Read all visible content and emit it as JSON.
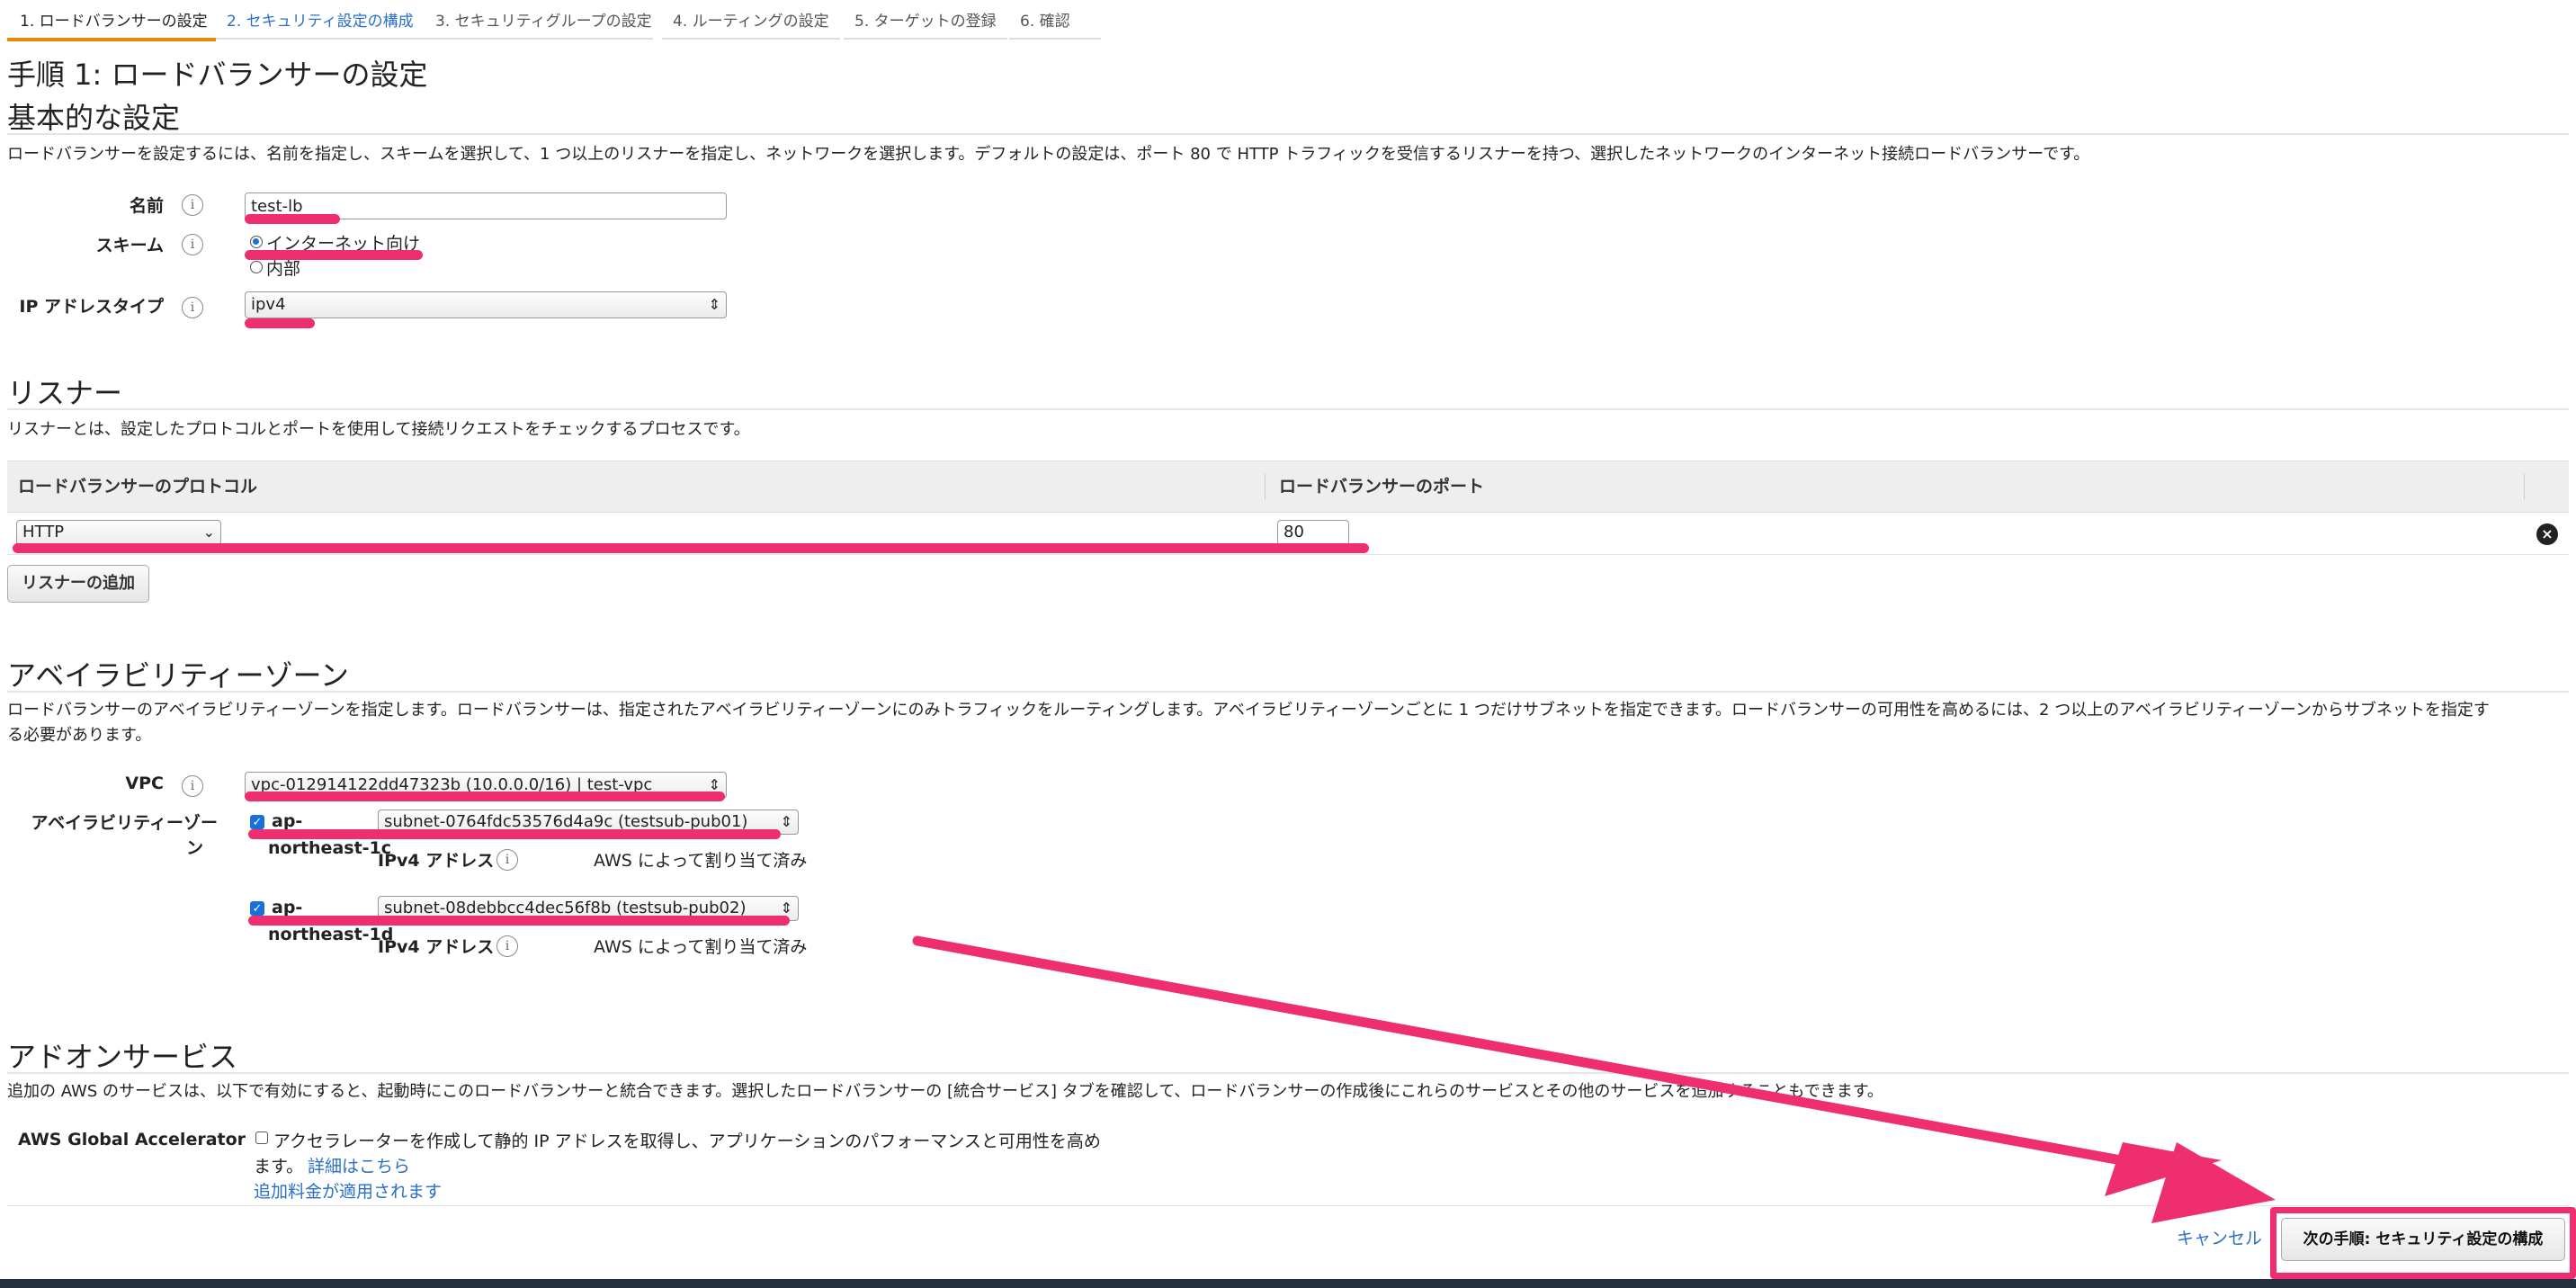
{
  "tabs": [
    {
      "label": "1. ロードバランサーの設定",
      "state": "active"
    },
    {
      "label": "2. セキュリティ設定の構成",
      "state": "link"
    },
    {
      "label": "3. セキュリティグループの設定",
      "state": "inactive"
    },
    {
      "label": "4. ルーティングの設定",
      "state": "inactive"
    },
    {
      "label": "5. ターゲットの登録",
      "state": "inactive"
    },
    {
      "label": "6. 確認",
      "state": "inactive"
    }
  ],
  "page_title": "手順 1: ロードバランサーの設定",
  "basic": {
    "title": "基本的な設定",
    "description": "ロードバランサーを設定するには、名前を指定し、スキームを選択して、1 つ以上のリスナーを指定し、ネットワークを選択します。デフォルトの設定は、ポート 80 で HTTP トラフィックを受信するリスナーを持つ、選択したネットワークのインターネット接続ロードバランサーです。",
    "name_label": "名前",
    "name_value": "test-lb",
    "scheme_label": "スキーム",
    "scheme_options": [
      "インターネット向け",
      "内部"
    ],
    "scheme_selected": "インターネット向け",
    "ip_label": "IP アドレスタイプ",
    "ip_value": "ipv4"
  },
  "listener": {
    "title": "リスナー",
    "description": "リスナーとは、設定したプロトコルとポートを使用して接続リクエストをチェックするプロセスです。",
    "col_protocol": "ロードバランサーのプロトコル",
    "col_port": "ロードバランサーのポート",
    "protocol_value": "HTTP",
    "port_value": "80",
    "add_button": "リスナーの追加"
  },
  "az": {
    "title": "アベイラビリティーゾーン",
    "description_line1": "ロードバランサーのアベイラビリティーゾーンを指定します。ロードバランサーは、指定されたアベイラビリティーゾーンにのみトラフィックをルーティングします。アベイラビリティーゾーンごとに 1 つだけサブネットを指定できます。ロードバランサーの可用性を高めるには、2 つ以上のアベイラビリティーゾーンからサブネットを指定す",
    "description_line2": "る必要があります。",
    "vpc_label": "VPC",
    "vpc_value": "vpc-012914122dd47323b (10.0.0.0/16) | test-vpc",
    "az_label_line1": "アベイラビリティーゾー",
    "az_label_line2": "ン",
    "zones": [
      {
        "name_line1": "ap-",
        "name_line2": "northeast-1c",
        "subnet": "subnet-0764fdc53576d4a9c (testsub-pub01)",
        "ipv4_label": "IPv4 アドレス",
        "ipv4_value": "AWS によって割り当て済み",
        "checked": true
      },
      {
        "name_line1": "ap-",
        "name_line2": "northeast-1d",
        "subnet": "subnet-08debbcc4dec56f8b (testsub-pub02)",
        "ipv4_label": "IPv4 アドレス",
        "ipv4_value": "AWS によって割り当て済み",
        "checked": true
      }
    ]
  },
  "addon": {
    "title": "アドオンサービス",
    "description": "追加の AWS のサービスは、以下で有効にすると、起動時にこのロードバランサーと統合できます。選択したロードバランサーの [統合サービス] タブを確認して、ロードバランサーの作成後にこれらのサービスとその他のサービスを追加することもできます。",
    "ga_label": "AWS Global Accelerator",
    "ga_text_line1": "アクセラレーターを作成して静的 IP アドレスを取得し、アプリケーションのパフォーマンスと可用性を高め",
    "ga_text_line2": "ます。",
    "ga_details_link": "詳細はこちら",
    "ga_charge_link": "追加料金が適用されます"
  },
  "footer": {
    "cancel": "キャンセル",
    "next": "次の手順: セキュリティ設定の構成"
  },
  "colors": {
    "annotation": "#ee2e6f",
    "active_tab": "#e98a00",
    "link": "#2a6fc9"
  }
}
